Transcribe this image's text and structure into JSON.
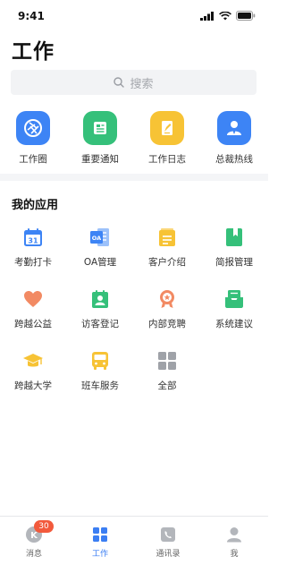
{
  "status_bar": {
    "time": "9:41"
  },
  "page": {
    "title": "工作"
  },
  "search": {
    "placeholder": "搜索"
  },
  "quick_actions": [
    {
      "label": "工作圈",
      "icon": "aperture-icon",
      "color": "#3d84f5"
    },
    {
      "label": "重要通知",
      "icon": "document-icon",
      "color": "#35c07a"
    },
    {
      "label": "工作日志",
      "icon": "pen-note-icon",
      "color": "#f7c335"
    },
    {
      "label": "总裁热线",
      "icon": "person-tie-icon",
      "color": "#3d84f5"
    }
  ],
  "my_apps": {
    "title": "我的应用",
    "items": [
      {
        "label": "考勤打卡",
        "icon": "calendar-31-icon",
        "color": "#3d84f5"
      },
      {
        "label": "OA管理",
        "icon": "oa-icon",
        "color": "#3d84f5"
      },
      {
        "label": "客户介绍",
        "icon": "clipboard-icon",
        "color": "#f7c335"
      },
      {
        "label": "简报管理",
        "icon": "bookmark-book-icon",
        "color": "#35c07a"
      },
      {
        "label": "跨越公益",
        "icon": "heart-icon",
        "color": "#f28a63"
      },
      {
        "label": "访客登记",
        "icon": "visitor-badge-icon",
        "color": "#35c07a"
      },
      {
        "label": "内部竞聘",
        "icon": "medal-icon",
        "color": "#f28a63"
      },
      {
        "label": "系统建议",
        "icon": "inbox-icon",
        "color": "#35c07a"
      },
      {
        "label": "跨越大学",
        "icon": "graduation-cap-icon",
        "color": "#f7c335"
      },
      {
        "label": "班车服务",
        "icon": "bus-icon",
        "color": "#f7c335"
      },
      {
        "label": "全部",
        "icon": "grid-icon",
        "color": "#9fa2a8"
      }
    ]
  },
  "tab_bar": {
    "tabs": [
      {
        "label": "消息",
        "badge": "30",
        "active": false
      },
      {
        "label": "工作",
        "active": true
      },
      {
        "label": "通讯录",
        "active": false
      },
      {
        "label": "我",
        "active": false
      }
    ]
  },
  "colors": {
    "accent": "#3b7ef3",
    "badge": "#f25a3c",
    "divider": "#f4f5f7"
  }
}
